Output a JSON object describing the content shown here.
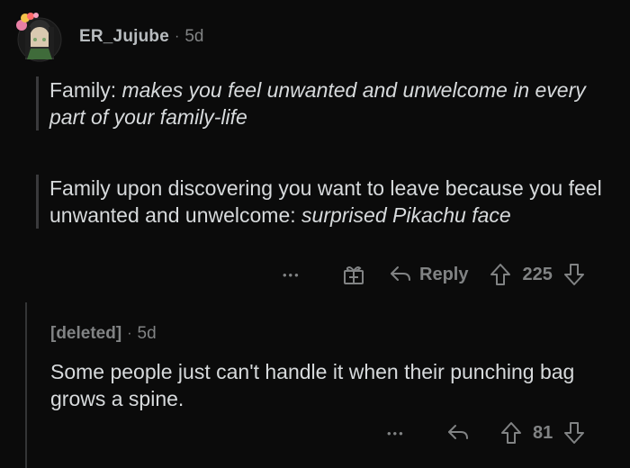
{
  "comment1": {
    "username": "ER_Jujube",
    "separator": "·",
    "age": "5d",
    "quote1": {
      "prefix": "Family: ",
      "italic": "makes you feel unwanted and unwelcome in every part of your family-life"
    },
    "quote2": {
      "prefix": "Family upon discovering you want to leave because you feel unwanted and unwelcome: ",
      "italic": "surprised Pikachu face"
    },
    "actions": {
      "more": "•••",
      "award_icon": "gift-icon",
      "reply_label": "Reply",
      "score": "225"
    }
  },
  "comment2": {
    "username": "[deleted]",
    "separator": "·",
    "age": "5d",
    "body": "Some people just can't handle it when their punching bag grows a spine.",
    "actions": {
      "more": "•••",
      "score": "81"
    }
  }
}
